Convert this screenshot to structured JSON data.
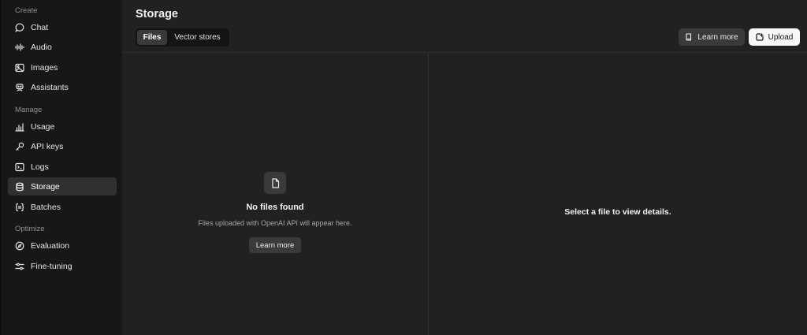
{
  "sidebar": {
    "sections": [
      {
        "label": "Create",
        "items": [
          {
            "label": "Chat",
            "icon": "chat-bubble-icon"
          },
          {
            "label": "Audio",
            "icon": "waveform-icon"
          },
          {
            "label": "Images",
            "icon": "image-icon"
          },
          {
            "label": "Assistants",
            "icon": "robot-icon"
          }
        ]
      },
      {
        "label": "Manage",
        "items": [
          {
            "label": "Usage",
            "icon": "bar-chart-icon"
          },
          {
            "label": "API keys",
            "icon": "key-icon"
          },
          {
            "label": "Logs",
            "icon": "terminal-icon"
          },
          {
            "label": "Storage",
            "icon": "database-icon",
            "active": true
          },
          {
            "label": "Batches",
            "icon": "braces-icon"
          }
        ]
      },
      {
        "label": "Optimize",
        "items": [
          {
            "label": "Evaluation",
            "icon": "compass-icon"
          },
          {
            "label": "Fine-tuning",
            "icon": "sliders-icon"
          }
        ]
      }
    ]
  },
  "header": {
    "title": "Storage",
    "tabs": [
      {
        "label": "Files",
        "active": true
      },
      {
        "label": "Vector stores",
        "active": false
      }
    ],
    "learn_more_label": "Learn more",
    "upload_label": "Upload"
  },
  "files_panel": {
    "empty_title": "No files found",
    "empty_subtitle": "Files uploaded with OpenAI API will appear here.",
    "learn_more_label": "Learn more"
  },
  "details_panel": {
    "placeholder": "Select a file to view details."
  },
  "colors": {
    "background": "#212121",
    "sidebar": "#171717",
    "active_item": "#303030",
    "upload_button": "#f7f7f7"
  }
}
